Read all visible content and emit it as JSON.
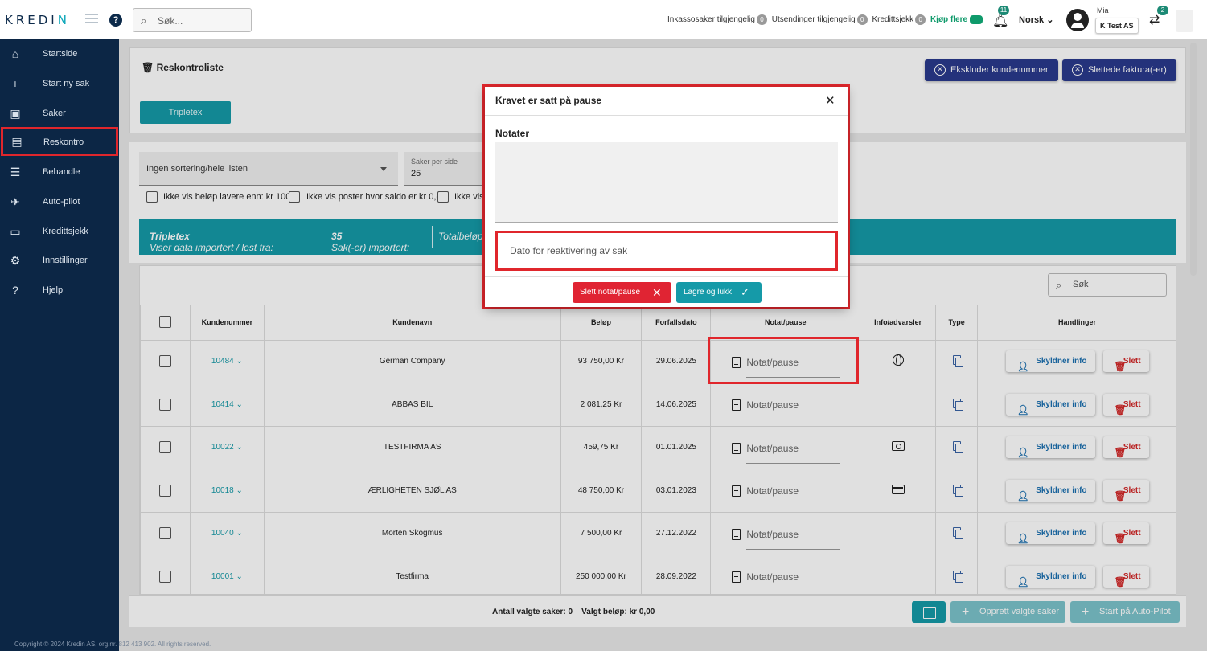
{
  "topbar": {
    "logo_a": "KREDI",
    "logo_b": "N",
    "search_placeholder": "Søk...",
    "stat_inkasso": "Inkassosaker tilgjengelig",
    "stat_inkasso_count": "0",
    "stat_utsendinger": "Utsendinger tilgjengelig",
    "stat_utsendinger_count": "0",
    "stat_kredittsjekk": "Kredittsjekk",
    "stat_kredittsjekk_count": "0",
    "buy_more": "Kjøp flere",
    "notifications_count": "11",
    "language": "Norsk",
    "user_name": "Mia",
    "company": "K Test AS",
    "switch_count": "2"
  },
  "sidebar": {
    "items": [
      {
        "label": "Startside",
        "icon": "home-icon"
      },
      {
        "label": "Start ny sak",
        "icon": "plus-icon"
      },
      {
        "label": "Saker",
        "icon": "briefcase-icon"
      },
      {
        "label": "Reskontro",
        "icon": "document-icon"
      },
      {
        "label": "Behandle",
        "icon": "checklist-icon"
      },
      {
        "label": "Auto-pilot",
        "icon": "airplane-icon"
      },
      {
        "label": "Kredittsjekk",
        "icon": "id-card-icon"
      },
      {
        "label": "Innstillinger",
        "icon": "gear-icon"
      },
      {
        "label": "Hjelp",
        "icon": "question-icon"
      }
    ],
    "copyright": "Copyright © 2024 Kredin AS, org.nr. 812 413 902. All rights reserved."
  },
  "header": {
    "title": "Reskontroliste",
    "exclude_button": "Ekskluder kundenummer",
    "deleted_button": "Slettede faktura(-er)",
    "tab": "Tripletex"
  },
  "filters": {
    "sort_value": "Ingen sortering/hele listen",
    "per_page_label": "Saker per side",
    "per_page_value": "25",
    "check1": "Ikke vis beløp lavere enn: kr 100",
    "check2": "Ikke vis poster hvor saldo er kr 0,-",
    "check3": "Ikke vis"
  },
  "banner": {
    "prefix": "Viser data importert / lest fra: ",
    "source": "Tripletex",
    "imported_prefix": "Sak(-er) importert: ",
    "imported_count": "35",
    "total_prefix": "Totalbeløp"
  },
  "table": {
    "search_placeholder": "Søk",
    "columns": [
      "Kundenummer",
      "Kundenavn",
      "Beløp",
      "Forfallsdato",
      "Notat/pause",
      "Info/advarsler",
      "Type",
      "Handlinger"
    ],
    "note_placeholder": "Notat/pause",
    "info_button": "Skyldner info",
    "delete_button": "Slett",
    "rows": [
      {
        "id": "10484",
        "name": "German Company",
        "amount": "93 750,00 Kr",
        "due": "29.06.2025",
        "info": "globe-icon"
      },
      {
        "id": "10414",
        "name": "ABBAS BIL",
        "amount": "2 081,25 Kr",
        "due": "14.06.2025",
        "info": ""
      },
      {
        "id": "10022",
        "name": "TESTFIRMA AS",
        "amount": "459,75 Kr",
        "due": "01.01.2025",
        "info": "money-icon"
      },
      {
        "id": "10018",
        "name": "ÆRLIGHETEN SJØL AS",
        "amount": "48 750,00 Kr",
        "due": "03.01.2023",
        "info": "credit-card-icon"
      },
      {
        "id": "10040",
        "name": "Morten Skogmus",
        "amount": "7 500,00 Kr",
        "due": "27.12.2022",
        "info": ""
      },
      {
        "id": "10001",
        "name": "Testfirma",
        "amount": "250 000,00 Kr",
        "due": "28.09.2022",
        "info": ""
      }
    ]
  },
  "footer": {
    "selected_count": "Antall valgte saker: 0",
    "selected_amount": "Valgt beløp: kr 0,00",
    "create_button": "Opprett valgte saker",
    "autopilot_button": "Start på Auto-Pilot"
  },
  "dialog": {
    "title": "Kravet er satt på pause",
    "notes_label": "Notater",
    "date_placeholder": "Dato for reaktivering av sak",
    "delete_button": "Slett notat/pause",
    "save_button": "Lagre og lukk"
  },
  "colors": {
    "sidebar": "#0c2645",
    "accent_teal": "#159aa8",
    "navy_button": "#2a3a8c",
    "highlight_red": "#e0262c"
  }
}
